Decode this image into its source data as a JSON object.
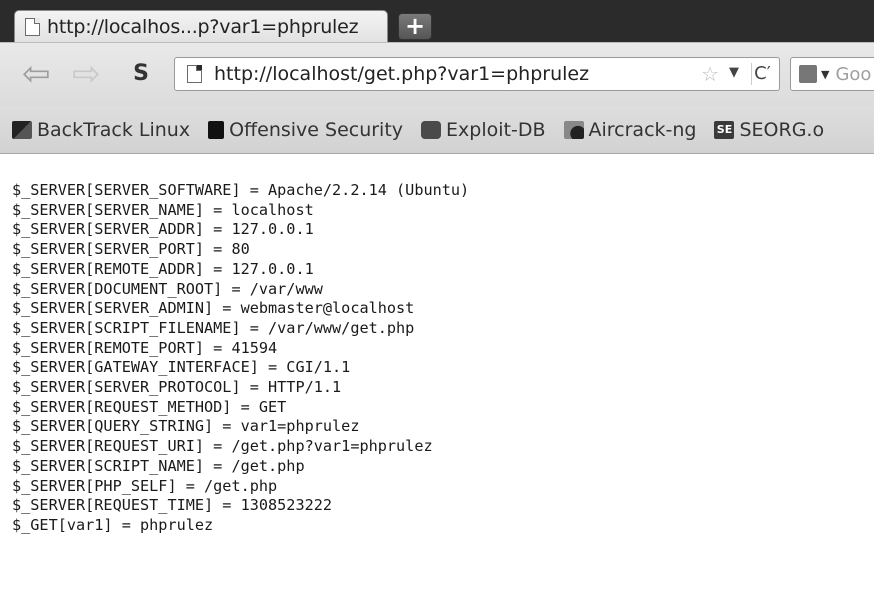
{
  "tab": {
    "title": "http://localhos...p?var1=phprulez",
    "new_tab_label": "+"
  },
  "navbar": {
    "back_icon": "back-arrow-icon",
    "forward_icon": "forward-arrow-icon",
    "sync_icon": "sync-icon",
    "url": "http://localhost/get.php?var1=phprulez",
    "search_placeholder": "Goo"
  },
  "bookmarks": [
    {
      "label": "BackTrack Linux",
      "icon": "backtrack-icon"
    },
    {
      "label": "Offensive Security",
      "icon": "offsec-icon"
    },
    {
      "label": "Exploit-DB",
      "icon": "exploitdb-icon"
    },
    {
      "label": "Aircrack-ng",
      "icon": "aircrack-icon"
    },
    {
      "label": "SEORG.o",
      "icon": "seorg-icon"
    }
  ],
  "content": {
    "lines": [
      "$_SERVER[SERVER_SOFTWARE] = Apache/2.2.14 (Ubuntu)",
      "$_SERVER[SERVER_NAME] = localhost",
      "$_SERVER[SERVER_ADDR] = 127.0.0.1",
      "$_SERVER[SERVER_PORT] = 80",
      "$_SERVER[REMOTE_ADDR] = 127.0.0.1",
      "$_SERVER[DOCUMENT_ROOT] = /var/www",
      "$_SERVER[SERVER_ADMIN] = webmaster@localhost",
      "$_SERVER[SCRIPT_FILENAME] = /var/www/get.php",
      "$_SERVER[REMOTE_PORT] = 41594",
      "$_SERVER[GATEWAY_INTERFACE] = CGI/1.1",
      "$_SERVER[SERVER_PROTOCOL] = HTTP/1.1",
      "$_SERVER[REQUEST_METHOD] = GET",
      "$_SERVER[QUERY_STRING] = var1=phprulez",
      "$_SERVER[REQUEST_URI] = /get.php?var1=phprulez",
      "$_SERVER[SCRIPT_NAME] = /get.php",
      "$_SERVER[PHP_SELF] = /get.php",
      "$_SERVER[REQUEST_TIME] = 1308523222",
      "$_GET[var1] = phprulez"
    ]
  }
}
